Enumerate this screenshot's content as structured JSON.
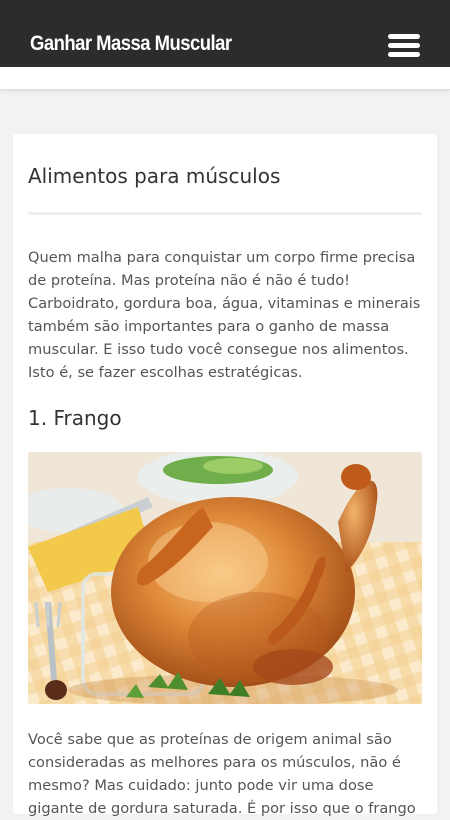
{
  "header": {
    "title": "Ganhar Massa Muscular",
    "menu_icon": "hamburger-menu-icon"
  },
  "article": {
    "title": "Alimentos para músculos",
    "intro": "Quem malha para conquistar um corpo firme precisa de proteína. Mas proteína não é não é tudo! Carboidrato, gordura boa, água, vitaminas e minerais também são importantes para o ganho de massa muscular. E isso tudo você consegue nos alimentos. Isto é, se fazer escolhas estratégicas.",
    "section_title": "1. Frango",
    "section_text": "Você sabe que as proteínas de origem animal são consideradas as melhores para os músculos, não é mesmo? Mas cuidado: junto pode vir uma dose gigante de gordura saturada. É por isso que o frango"
  },
  "colors": {
    "topbar": "#2c2c2c",
    "background": "#f2f2f2",
    "card": "#ffffff",
    "text": "#555555",
    "heading": "#333333"
  }
}
